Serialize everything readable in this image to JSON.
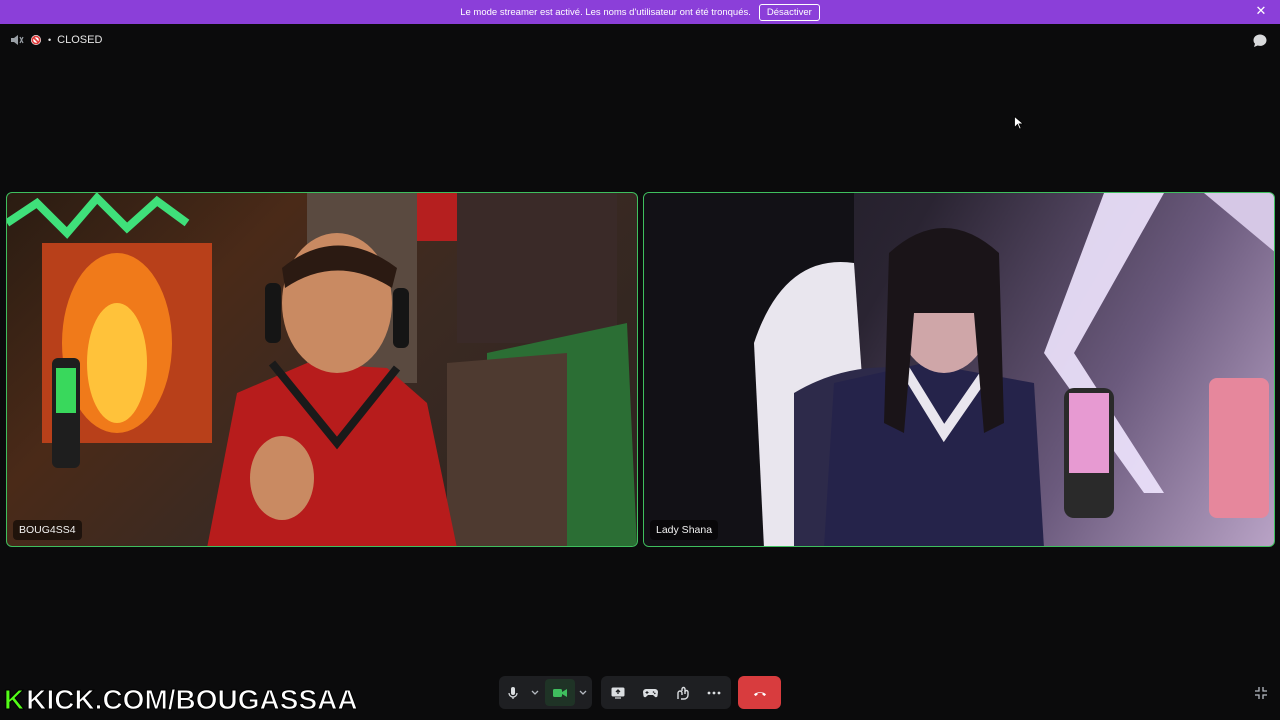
{
  "banner": {
    "message": "Le mode streamer est activé. Les noms d'utilisateur ont été tronqués.",
    "button_label": "Désactiver",
    "close_glyph": "✕"
  },
  "topbar": {
    "status_label": "CLOSED",
    "bullet": "•"
  },
  "participants": [
    {
      "name": "BOUG4SS4"
    },
    {
      "name": "Lady Shana"
    }
  ],
  "overlay": {
    "kick_k": "K",
    "kick_text": "KICK.COM/BOUGASSAA"
  },
  "colors": {
    "banner": "#8b3fd9",
    "speaking_border": "#3fbf5e",
    "hangup": "#d83c3e",
    "kick_green": "#53fc18"
  },
  "icons": [
    "speaker-icon",
    "no-entry-icon",
    "chat-bubble-icon",
    "microphone-icon",
    "chevron-down-icon",
    "camera-icon",
    "screen-share-icon",
    "gamepad-icon",
    "activity-icon",
    "more-icon",
    "hang-up-icon",
    "collapse-icon",
    "cursor-icon"
  ]
}
